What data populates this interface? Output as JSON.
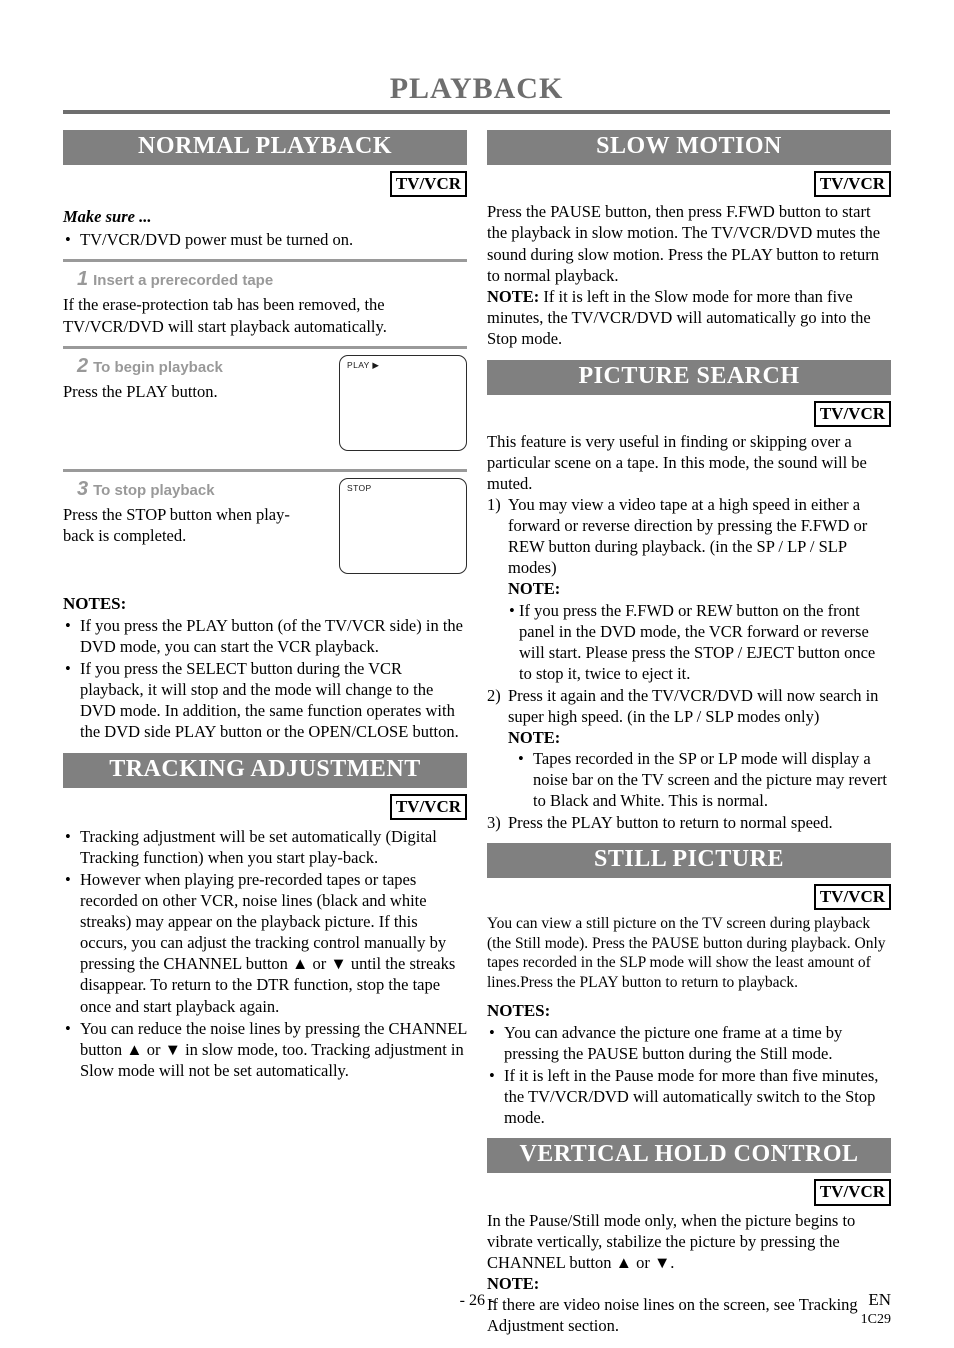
{
  "page": {
    "title": "PLAYBACK",
    "footer_page_number": "- 26 -",
    "footer_language": "EN",
    "footer_code": "1C29",
    "accent_gray": "#808080",
    "title_gray": "#6e6e6e",
    "step_label_gray": "#999999"
  },
  "badges": {
    "tv_vcr": "TV/VCR"
  },
  "left_column": {
    "normal_playback": {
      "heading": "NORMAL PLAYBACK",
      "badge": "TV/VCR",
      "make_sure_label": "Make sure ...",
      "make_sure_items": [
        "TV/VCR/DVD power must be turned on."
      ],
      "steps": [
        {
          "number": "1",
          "label": "Insert a prerecorded tape",
          "body": "If the erase-protection tab has been removed, the TV/VCR/DVD will start playback automatically.",
          "illustration": null
        },
        {
          "number": "2",
          "label": "To begin playback",
          "body": "Press the PLAY button.",
          "illustration": "PLAY ▶"
        },
        {
          "number": "3",
          "label": "To stop playback",
          "body": "Press the STOP button when play-back is completed.",
          "illustration": "STOP"
        }
      ],
      "notes_heading": "NOTES:",
      "notes": [
        "If you press the PLAY button (of the TV/VCR side) in the DVD mode, you can start the VCR playback.",
        "If you press the SELECT button during the VCR playback, it will stop and the mode will change to the DVD mode. In addition, the same function operates with the DVD side PLAY button or the OPEN/CLOSE button."
      ]
    },
    "tracking_adjustment": {
      "heading": "TRACKING ADJUSTMENT",
      "badge": "TV/VCR",
      "bullets": [
        "Tracking adjustment will be set automatically (Digital Tracking function) when you start play-back.",
        "However when playing pre-recorded tapes or tapes recorded on other VCR, noise lines (black and white streaks) may appear on the playback picture. If this occurs, you can adjust the tracking control manually by pressing the CHANNEL button ▲ or ▼ until the streaks disappear. To return to the DTR function, stop the tape once and start playback again.",
        "You can reduce the noise lines by pressing the CHANNEL button ▲ or ▼ in slow mode, too. Tracking adjustment in Slow mode will not be set automatically."
      ]
    }
  },
  "right_column": {
    "slow_motion": {
      "heading": "SLOW MOTION",
      "badge": "TV/VCR",
      "body": "Press the PAUSE button, then press F.FWD button to start the playback in slow motion. The TV/VCR/DVD mutes the sound during slow motion. Press the PLAY button to return to normal playback.",
      "note_label": "NOTE:",
      "note_body": "If it is left in the Slow mode for more than five minutes, the TV/VCR/DVD will automatically go into the Stop mode."
    },
    "picture_search": {
      "heading": "PICTURE SEARCH",
      "badge": "TV/VCR",
      "intro": "This feature is very useful in finding or skipping over a particular scene on a tape. In this mode, the sound will be muted.",
      "items": [
        {
          "marker": "1)",
          "text": "You may view a video tape at a high speed in either a forward or reverse direction by pressing the F.FWD or REW button during playback. (in the SP / LP / SLP modes)",
          "note_heading": "NOTE:",
          "note_bullets": [
            "If you press the F.FWD or REW button on the front panel in the DVD mode, the VCR forward or reverse will start. Please press the STOP / EJECT button once to stop it, twice to eject it."
          ]
        },
        {
          "marker": "2)",
          "text": "Press it again and the TV/VCR/DVD will now search in super high speed. (in the LP / SLP modes only)",
          "note_heading": "NOTE:",
          "note_bullets": [
            "Tapes recorded in the SP or LP mode will display a noise bar on the TV screen and the picture may revert to Black and White. This is normal."
          ]
        },
        {
          "marker": "3)",
          "text": "Press the PLAY button to return to normal speed.",
          "note_heading": null,
          "note_bullets": []
        }
      ]
    },
    "still_picture": {
      "heading": "STILL PICTURE",
      "badge": "TV/VCR",
      "body": "You can view a still picture on the TV screen during playback (the Still mode). Press the PAUSE button during playback. Only tapes recorded in the SLP mode will show the least amount of lines.Press the PLAY button to return to playback.",
      "notes_heading": "NOTES:",
      "notes": [
        "You can advance the picture one frame at a time by pressing the PAUSE button during the Still mode.",
        "If it is left in the Pause mode for more than five minutes, the TV/VCR/DVD will automatically switch to the Stop mode."
      ]
    },
    "vertical_hold_control": {
      "heading": "VERTICAL HOLD CONTROL",
      "badge": "TV/VCR",
      "body": "In the Pause/Still mode only, when the picture begins to vibrate vertically, stabilize the picture by pressing the CHANNEL button ▲ or ▼.",
      "note_heading": "NOTE:",
      "note_body": "If there are video noise lines on the screen, see Tracking Adjustment section."
    }
  }
}
